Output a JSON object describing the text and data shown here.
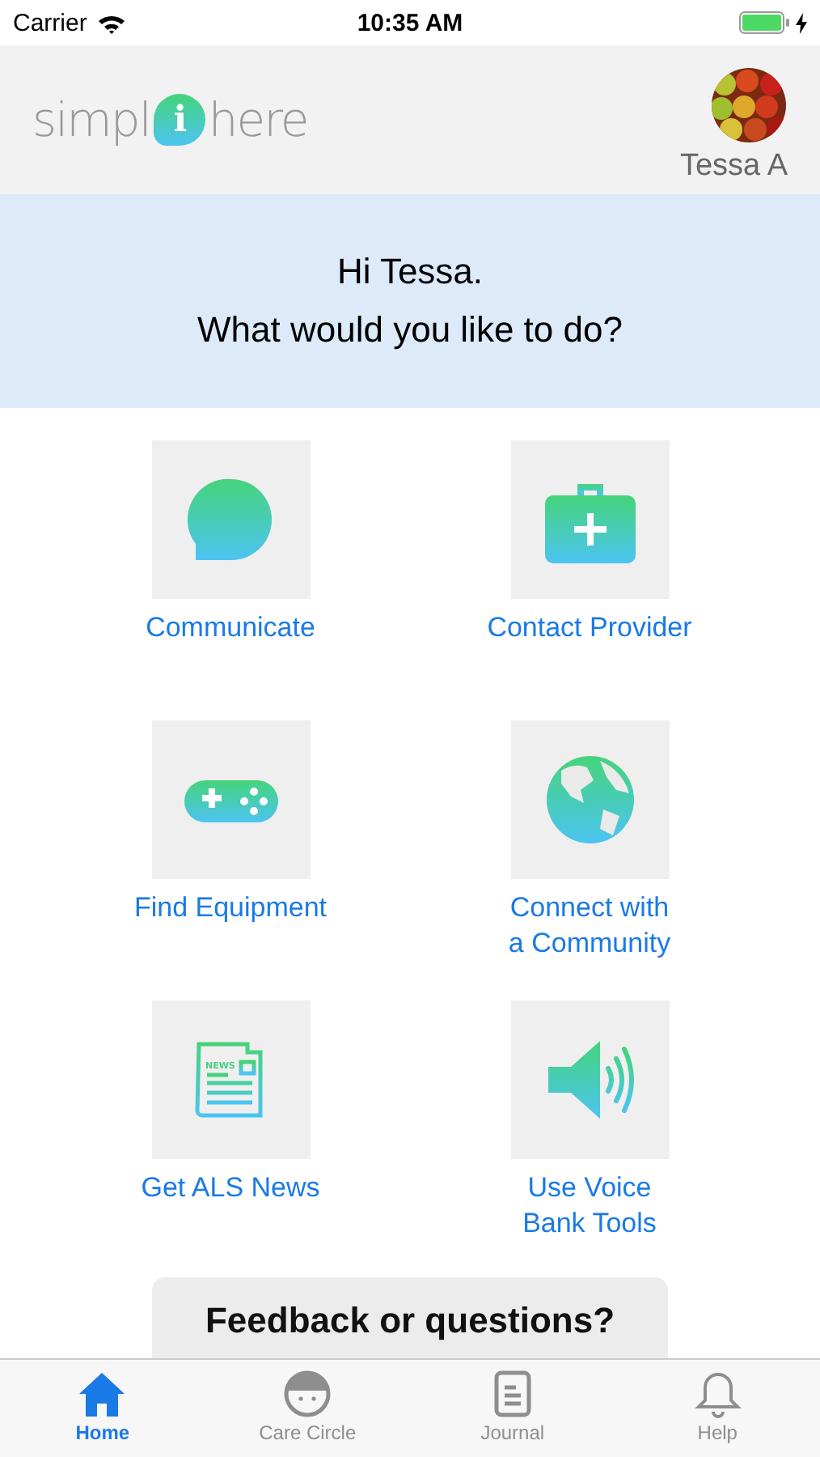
{
  "status_bar": {
    "carrier": "Carrier",
    "time": "10:35 AM",
    "charging": true
  },
  "header": {
    "logo": {
      "before": "simpl",
      "mark": "i",
      "after": "here"
    },
    "user_name": "Tessa A"
  },
  "greeting": {
    "line_1": "Hi Tessa.",
    "line_2": "What would you like to do?"
  },
  "actions": [
    {
      "kind": "chat",
      "label": "Communicate"
    },
    {
      "kind": "medkit",
      "label": "Contact Provider"
    },
    {
      "kind": "gamepad",
      "label": "Find Equipment"
    },
    {
      "kind": "globe",
      "label": "Connect with\na Community"
    },
    {
      "kind": "news",
      "label": "Get ALS News",
      "icon_text": "NEWS"
    },
    {
      "kind": "speaker",
      "label": "Use Voice\nBank Tools"
    }
  ],
  "feedback": {
    "title": "Feedback or questions?"
  },
  "tab_bar": [
    {
      "kind": "home",
      "label": "Home",
      "selected": true
    },
    {
      "kind": "face",
      "label": "Care Circle",
      "selected": false
    },
    {
      "kind": "journal",
      "label": "Journal",
      "selected": false
    },
    {
      "kind": "bell",
      "label": "Help",
      "selected": false
    }
  ]
}
